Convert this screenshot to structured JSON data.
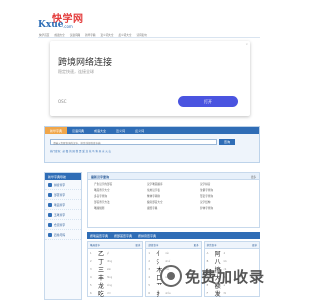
{
  "logo": {
    "cn": "快学网",
    "en": "Kxue",
    "com": ".com"
  },
  "topnav": [
    "快学首页",
    "成语大全",
    "汉语词典",
    "新华字典",
    "近义词大全",
    "反义词大全",
    "诗词名句"
  ],
  "ad": {
    "title": "跨境网络连接",
    "subtitle": "稳定快速，连接全球",
    "brand": "OSC",
    "button": "打开",
    "close": "×"
  },
  "search": {
    "tabs": [
      "新华字典",
      "汉语词典",
      "成语大全",
      "近义词",
      "反义词"
    ],
    "active_tab": 0,
    "placeholder": "请输入您要查询的汉字、拼音或部首查字典",
    "go": "查询",
    "hot": "热门查询：必 慢 的 国 我 是 爱 龙 花 马 鱼 天 水 火 山"
  },
  "side": {
    "header": "新华字典导航",
    "items": [
      "拼音查字",
      "部首查字",
      "笔画查字",
      "五笔查字",
      "仓颉查字",
      "四角号码"
    ]
  },
  "main": {
    "header": "最新汉字查询",
    "more": "更多",
    "links": [
      "产生汉字的部首",
      "汉字笔画顺序",
      "汉字拼音",
      "笔画查字大全",
      "常用汉字表",
      "生僻字查询",
      "多音字查询",
      "繁体字转换",
      "形近字查询",
      "部首查字方法",
      "偏旁部首大全",
      "汉字结构",
      "笔顺规则",
      "康熙字典",
      "异体字查询"
    ]
  },
  "lower": {
    "tabs": [
      "按笔画查字典",
      "按部首查字典",
      "按拼音查字典"
    ],
    "columns": [
      {
        "title": "笔画查字",
        "more": "更多",
        "rows": [
          {
            "n": "1",
            "c": "乙",
            "p": "yǐ"
          },
          {
            "n": "2",
            "c": "丁",
            "p": "dīng"
          },
          {
            "n": "3",
            "c": "三",
            "p": "sān"
          },
          {
            "n": "4",
            "c": "丰",
            "p": "fēng"
          },
          {
            "n": "5",
            "c": "龙",
            "p": "lóng"
          },
          {
            "n": "6",
            "c": "吃",
            "p": "chī"
          }
        ]
      },
      {
        "title": "部首查字",
        "more": "更多",
        "rows": [
          {
            "n": "1",
            "c": "亻",
            "p": "rén"
          },
          {
            "n": "2",
            "c": "氵",
            "p": "shuǐ"
          },
          {
            "n": "3",
            "c": "木",
            "p": "mù"
          },
          {
            "n": "4",
            "c": "口",
            "p": "kǒu"
          },
          {
            "n": "5",
            "c": "艹",
            "p": "cǎo"
          },
          {
            "n": "6",
            "c": "扌",
            "p": "shǒu"
          }
        ]
      },
      {
        "title": "拼音查字",
        "more": "更多",
        "rows": [
          {
            "n": "A",
            "c": "阿",
            "p": "ā"
          },
          {
            "n": "B",
            "c": "八",
            "p": "bā"
          },
          {
            "n": "C",
            "c": "擦",
            "p": "cā"
          },
          {
            "n": "D",
            "c": "大",
            "p": "dà"
          },
          {
            "n": "E",
            "c": "额",
            "p": "é"
          },
          {
            "n": "F",
            "c": "发",
            "p": "fā"
          }
        ]
      }
    ]
  },
  "watermark": {
    "text": "免费加收录"
  },
  "colors": {
    "primary": "#2f6db6",
    "accent": "#f0a64a",
    "ad_button": "#4a54e0",
    "logo_red": "#e33b3b"
  }
}
